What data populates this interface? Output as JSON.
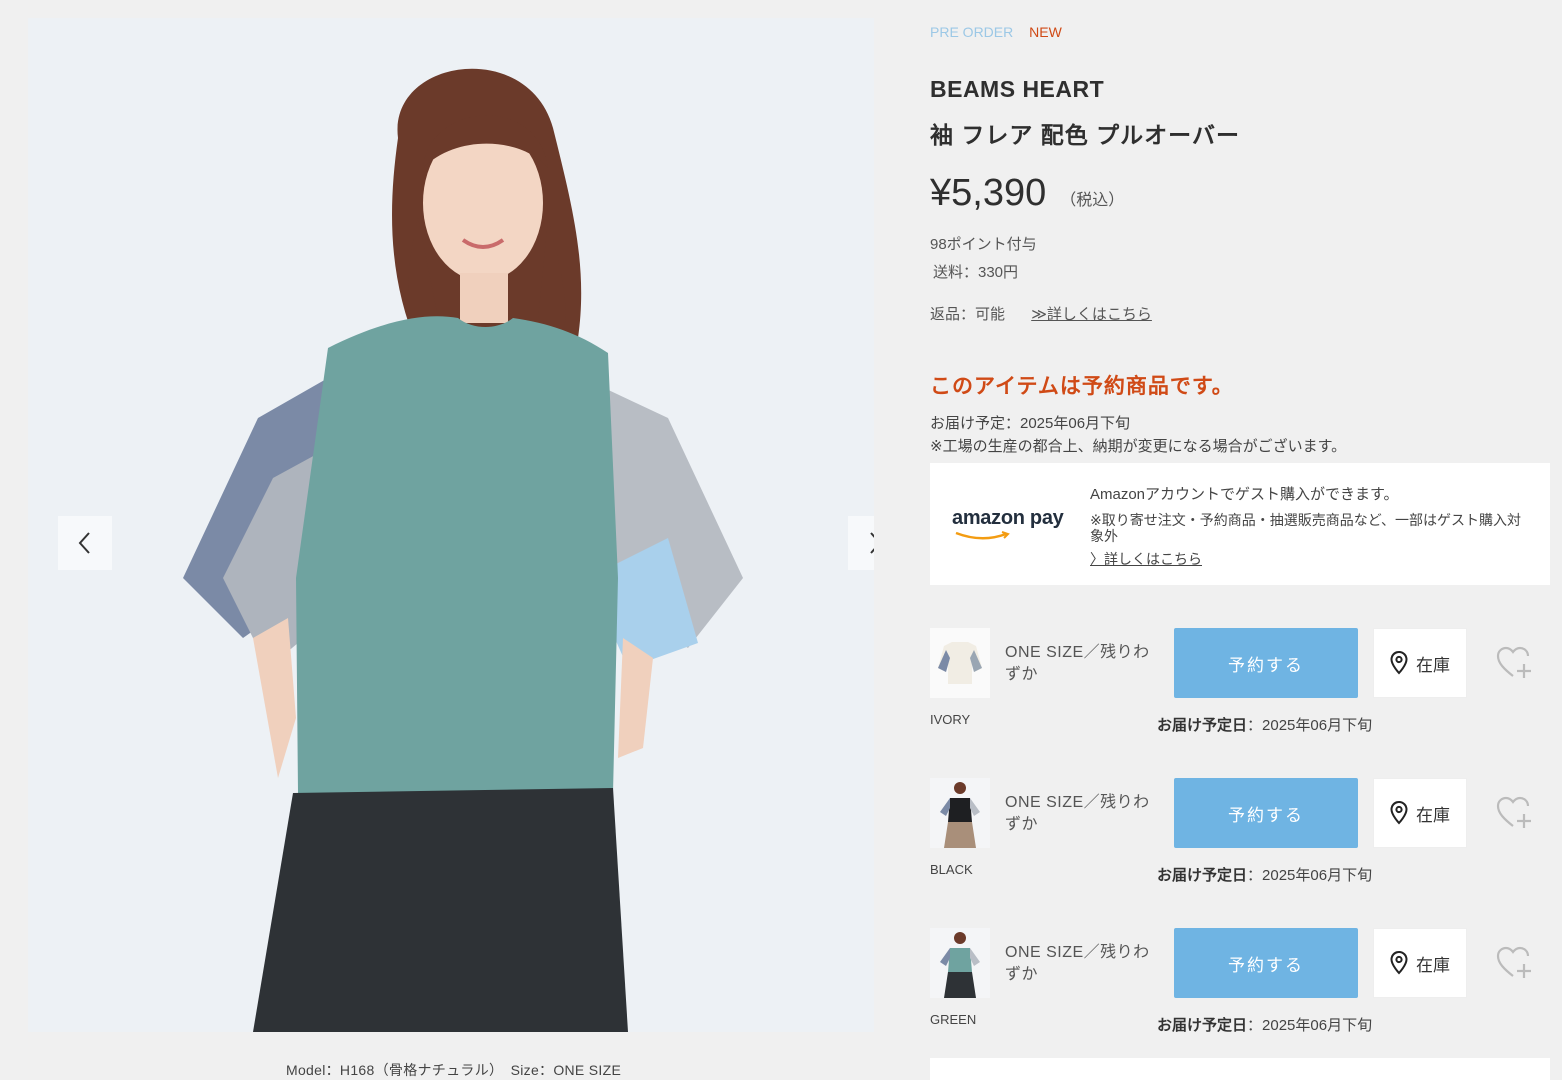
{
  "tags": {
    "preorder": "PRE ORDER",
    "new": "NEW"
  },
  "product": {
    "brand": "BEAMS HEART",
    "name": "袖 フレア 配色 プルオーバー",
    "price": "¥5,390",
    "tax_note": "（税込）",
    "points": "98ポイント付与",
    "shipping": "送料：330円",
    "returns": "返品：可能",
    "returns_link": "≫詳しくはこちら"
  },
  "preorder": {
    "notice": "このアイテムは予約商品です。",
    "delivery_line": "お届け予定：2025年06月下旬",
    "disclaimer": "※工場の生産の都合上、納期が変更になる場合がございます。"
  },
  "amazon_pay": {
    "logo": "amazon pay",
    "line1": "Amazonアカウントでゲスト購入ができます。",
    "line2": "※取り寄せ注文・予約商品・抽選販売商品など、一部はゲスト購入対象外",
    "link": "〉詳しくはこちら"
  },
  "gallery": {
    "caption": "Model：H168（骨格ナチュラル）　Size：ONE SIZE"
  },
  "variants": [
    {
      "color": "IVORY",
      "size": "ONE SIZE／残りわずか",
      "button": "予約する",
      "stock": "在庫",
      "delivery_label": "お届け予定日",
      "delivery_value": "：2025年06月下旬"
    },
    {
      "color": "BLACK",
      "size": "ONE SIZE／残りわずか",
      "button": "予約する",
      "stock": "在庫",
      "delivery_label": "お届け予定日",
      "delivery_value": "：2025年06月下旬"
    },
    {
      "color": "GREEN",
      "size": "ONE SIZE／残りわずか",
      "button": "予約する",
      "stock": "在庫",
      "delivery_label": "お届け予定日",
      "delivery_value": "：2025年06月下旬"
    }
  ],
  "colors": {
    "accent_blue": "#6fb4e3",
    "preorder_tag": "#9cc8e6",
    "alert_orange": "#d04a16"
  },
  "icons": [
    "chevron-left-icon",
    "chevron-right-icon",
    "map-pin-icon",
    "heart-plus-icon",
    "amazon-smile-icon"
  ]
}
